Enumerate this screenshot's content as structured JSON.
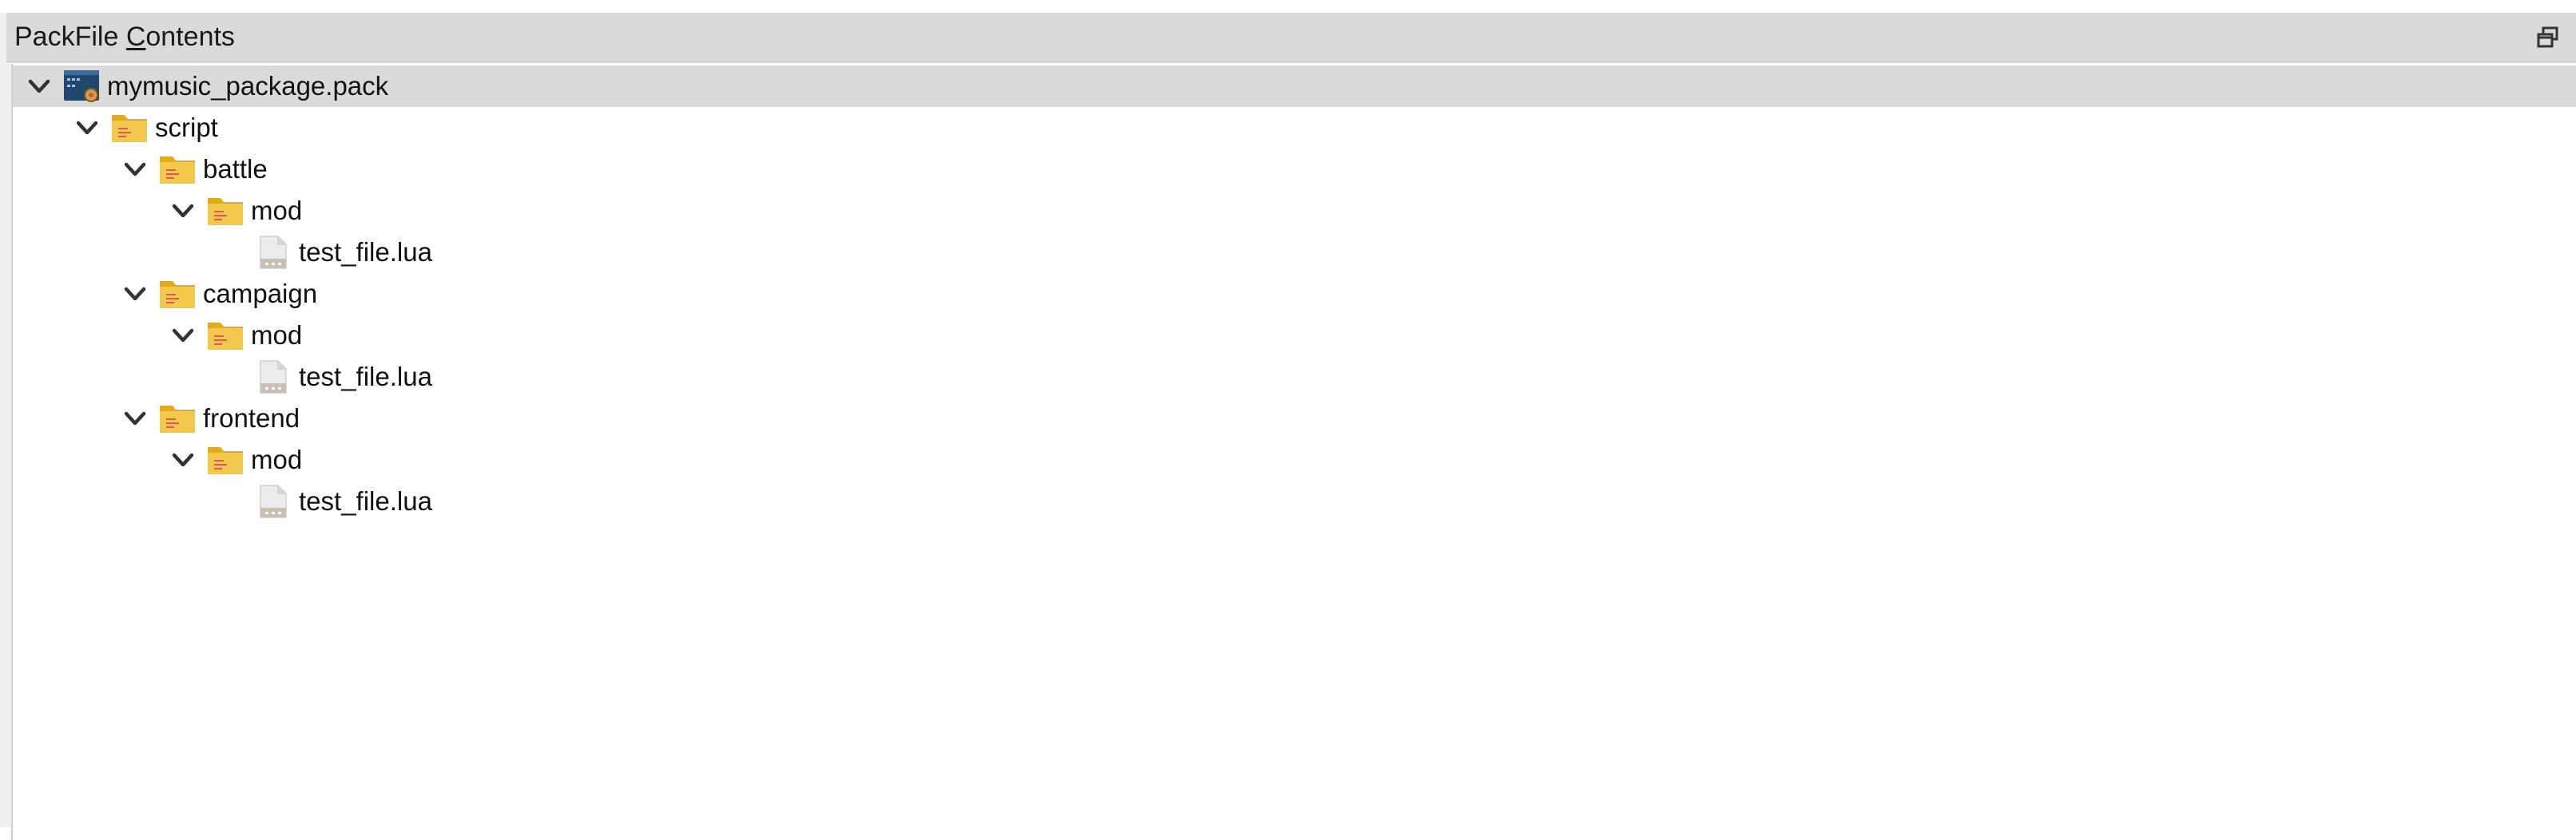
{
  "panel": {
    "title_prefix": "PackFile ",
    "title_mnemonic": "C",
    "title_suffix": "ontents",
    "float_button_icon": "float-window-icon"
  },
  "tree": {
    "rows": [
      {
        "label": "mymusic_package.pack",
        "type": "pack",
        "expanded": true,
        "selected": true
      },
      {
        "label": "script",
        "type": "folder",
        "expanded": true
      },
      {
        "label": "battle",
        "type": "folder",
        "expanded": true
      },
      {
        "label": "mod",
        "type": "folder",
        "expanded": true
      },
      {
        "label": "test_file.lua",
        "type": "file"
      },
      {
        "label": "campaign",
        "type": "folder",
        "expanded": true
      },
      {
        "label": "mod",
        "type": "folder",
        "expanded": true
      },
      {
        "label": "test_file.lua",
        "type": "file"
      },
      {
        "label": "frontend",
        "type": "folder",
        "expanded": true
      },
      {
        "label": "mod",
        "type": "folder",
        "expanded": true
      },
      {
        "label": "test_file.lua",
        "type": "file"
      }
    ]
  },
  "colors": {
    "folder": "#f2c94c",
    "folder_dark": "#e0ac1c",
    "selection": "#dadada",
    "header": "#dadada"
  }
}
